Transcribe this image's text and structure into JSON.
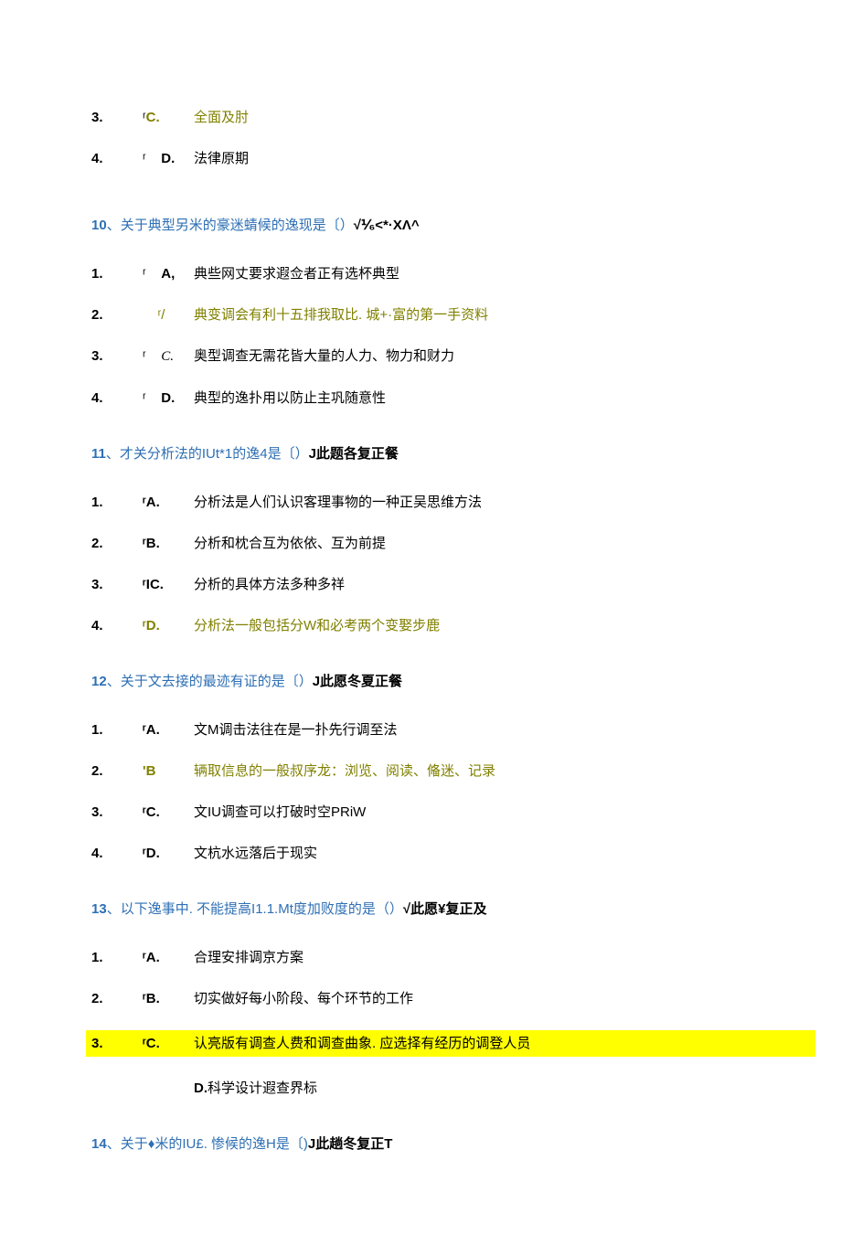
{
  "q9": {
    "options": [
      {
        "n": "3.",
        "m": "ʳ",
        "l": "C.",
        "t": "全面及肘",
        "cls": "olive"
      },
      {
        "n": "4.",
        "m": "ʳ",
        "l": "D.",
        "t": "法律原期",
        "cls": "plain"
      }
    ]
  },
  "q10": {
    "num": "10",
    "sep": "、",
    "txt": "关于典型另米的豪迷蜻候的逸现是〔）",
    "note": "√⅟₆<*·XΛ^",
    "options": [
      {
        "n": "1.",
        "m": "ʳ",
        "l": "A,",
        "t": "典些网丈要求遐佥者正有选杯典型",
        "cls": "plain"
      },
      {
        "n": "2.",
        "m": "",
        "l": "ʳ/",
        "t": "典变调会有利十五排我取比. 城+·富的第一手资料",
        "cls": "olive"
      },
      {
        "n": "3.",
        "m": "ʳ",
        "l": "C.",
        "t": "奥型调查无需花皆大量的人力、物力和财力",
        "cls": "plain font-kai"
      },
      {
        "n": "4.",
        "m": "ʳ",
        "l": "D.",
        "t": "典型的逸扑用以防止主巩随意性",
        "cls": "plain"
      }
    ]
  },
  "q11": {
    "num": "11",
    "sep": "、",
    "txt": "才关分析法的IUt*1的逸4是〔）",
    "note": "J此题各复正餐",
    "options": [
      {
        "n": "1.",
        "m": "",
        "l": "ʳA.",
        "t": "分析法是人们认识客理事物的一种正吴思维方法",
        "cls": "plain"
      },
      {
        "n": "2.",
        "m": "",
        "l": "ʳB.",
        "t": "分析和枕合互为依依、互为前提",
        "cls": "plain"
      },
      {
        "n": "3.",
        "m": "",
        "l": "ʳIC.",
        "t": "分析的具体方法多种多祥",
        "cls": "plain"
      },
      {
        "n": "4.",
        "m": "",
        "l": "ʳD.",
        "t": "分析法一般包括分W和必考两个变娶步鹿",
        "cls": "olive"
      }
    ]
  },
  "q12": {
    "num": "12",
    "sep": "、",
    "txt": "关于文去接的最迹有证的是〔）",
    "note": "J此愿冬夏正餐",
    "options": [
      {
        "n": "1.",
        "m": "",
        "l": "ʳA.",
        "t": "文M调击法往在是一扑先行调至法",
        "cls": "plain"
      },
      {
        "n": "2.",
        "m": "",
        "l": "'B",
        "t": "辆取信息的一般叔序龙：浏览、阅读、偹迷、记录",
        "cls": "olive"
      },
      {
        "n": "3.",
        "m": "",
        "l": "ʳC.",
        "t": "文IU调查可以打破时空PRiW",
        "cls": "plain"
      },
      {
        "n": "4.",
        "m": "",
        "l": "ʳD.",
        "t": "文杭水远落后于现实",
        "cls": "plain"
      }
    ]
  },
  "q13": {
    "num": "13",
    "sep": "、",
    "txt": "以下逸事中. 不能提高I1.1.Mt度加败度的是（）",
    "note": " √此愿¥复正及",
    "options": [
      {
        "n": "1.",
        "m": "",
        "l": "ʳA.",
        "t": "合理安排调京方案",
        "cls": "plain"
      },
      {
        "n": "2.",
        "m": "",
        "l": "ʳB.",
        "t": "切实做好每小阶段、每个环节的工作",
        "cls": "plain"
      },
      {
        "n": "3.",
        "m": "",
        "l": "ʳC.",
        "t": "认亮版有调查人费和调查曲象. 应选择有经历的调登人员",
        "cls": "plain",
        "hl": true
      },
      {
        "n": "",
        "m": "",
        "l": "D.",
        "t": "科学设计遐查界标",
        "cls": "plain",
        "ind": true
      }
    ]
  },
  "q14": {
    "num": "14",
    "sep": "、",
    "txt": "关于♦米的IU£. 惨候的逸H是〔)",
    "note": "J此趟冬复正T"
  }
}
